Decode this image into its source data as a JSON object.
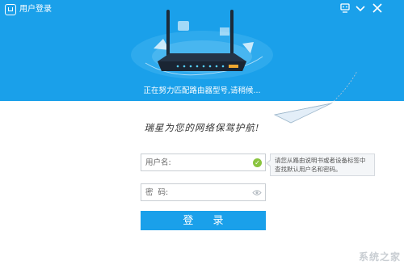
{
  "window": {
    "title": "用户登录",
    "controls": [
      "shirt-icon",
      "minimize-icon",
      "close-icon"
    ]
  },
  "header": {
    "status_text": "正在努力匹配路由器型号,请稍候..."
  },
  "slogan": "瑞星为您的网络保驾护航!",
  "form": {
    "username_placeholder": "用户名:",
    "password_placeholder": "密  码:",
    "tip_text": "请您从路由说明书或者设备标签中查找默认用户名和密码。",
    "login_label": "登 录"
  },
  "watermark": "系统之家",
  "colors": {
    "accent": "#1aa0ea",
    "ok": "#8ac43f"
  }
}
